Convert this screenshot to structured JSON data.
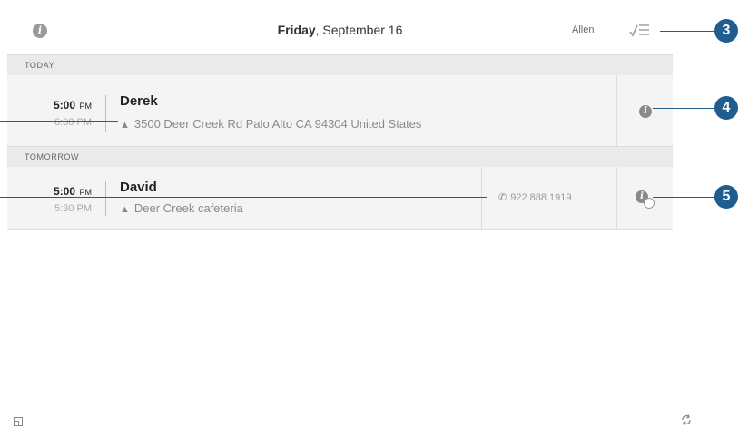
{
  "header": {
    "day": "Friday",
    "date": ", September 16",
    "user": "Allen",
    "info_icon": "info-icon",
    "task_icon": "checklist-icon"
  },
  "sections": {
    "today": "TODAY",
    "tomorrow": "TOMORROW"
  },
  "appointments": [
    {
      "start_time": "5:00",
      "start_ampm": "PM",
      "end_time": "6:00 PM",
      "name": "Derek",
      "location": "3500 Deer Creek Rd Palo Alto CA 94304 United States",
      "location_icon": "navigation-arrow-icon",
      "action_icon": "info-icon"
    },
    {
      "start_time": "5:00",
      "start_ampm": "PM",
      "end_time": "5:30 PM",
      "name": "David",
      "location": "Deer Creek cafeteria",
      "location_icon": "navigation-arrow-icon",
      "phone": "922 888 1919",
      "phone_icon": "phone-icon",
      "action_icon": "info-checked-icon"
    }
  ],
  "footer": {
    "left_icon": "window-icon",
    "right_icon": "sync-icon"
  },
  "callouts": {
    "badge_3": "3",
    "badge_4": "4",
    "badge_5": "5",
    "color": "#1f5c8f"
  }
}
